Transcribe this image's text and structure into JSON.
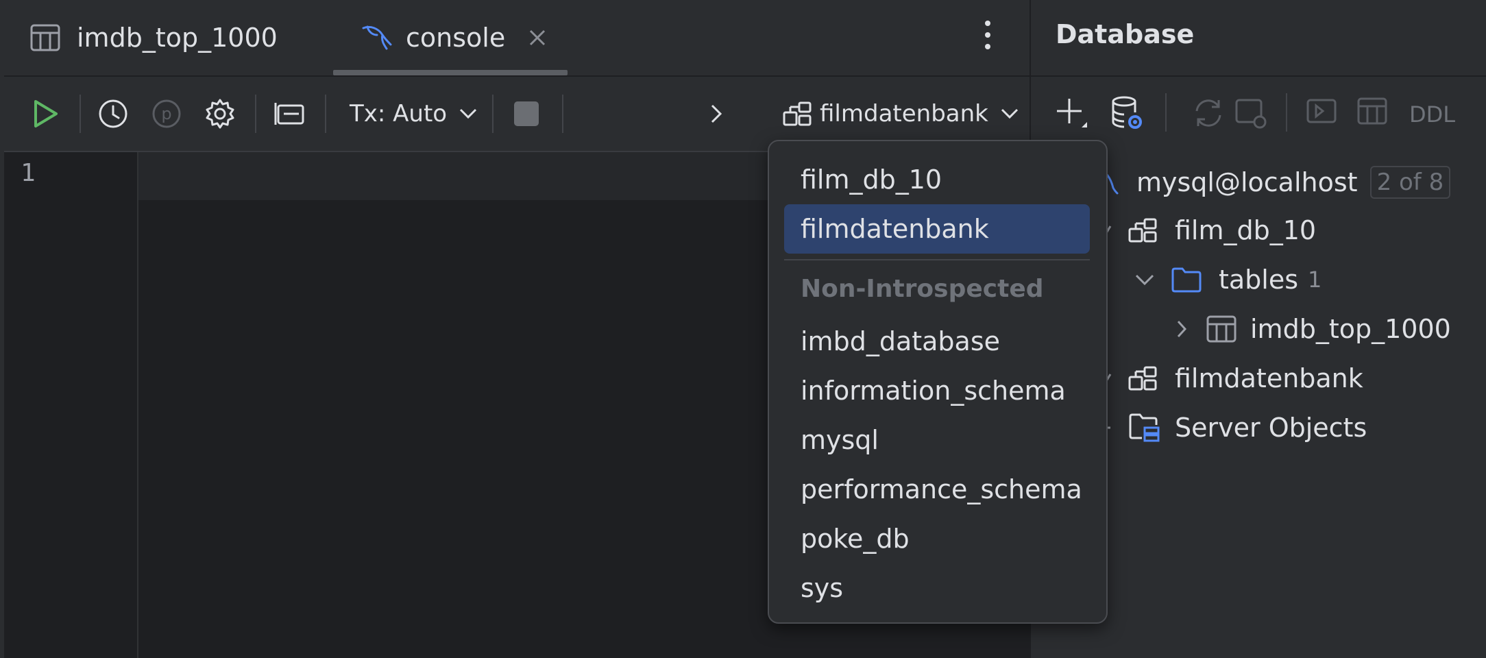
{
  "editor": {
    "tabs": [
      {
        "label": "imdb_top_1000",
        "icon": "table-icon",
        "active": false
      },
      {
        "label": "console",
        "icon": "mysql-dolphin-icon",
        "active": true
      }
    ],
    "toolbar": {
      "tx_mode": "Tx: Auto",
      "current_schema": "filmdatenbank",
      "icons": [
        "run-icon",
        "history-icon",
        "parameters-icon",
        "settings-icon",
        "layout-icon",
        "stop-icon",
        "chevron-right-icon",
        "schema-icon"
      ]
    },
    "line_numbers": [
      "1"
    ]
  },
  "schema_dropdown": {
    "introspected": [
      "film_db_10",
      "filmdatenbank"
    ],
    "selected": "filmdatenbank",
    "group_label": "Non-Introspected",
    "non_introspected": [
      "imbd_database",
      "information_schema",
      "mysql",
      "performance_schema",
      "poke_db",
      "sys"
    ]
  },
  "database_panel": {
    "title": "Database",
    "toolbar": {
      "ddl_label": "DDL"
    },
    "tree": {
      "connection": {
        "label": "mysql@localhost",
        "badge": "2 of 8"
      },
      "schemas": [
        {
          "label": "film_db_10",
          "children": [
            {
              "label": "tables",
              "count": "1",
              "children": [
                {
                  "label": "imdb_top_1000"
                }
              ]
            }
          ]
        },
        {
          "label": "filmdatenbank"
        }
      ],
      "server_objects": "Server Objects"
    }
  },
  "colors": {
    "selection": "#2e436e",
    "accent_blue": "#548af7",
    "run_green": "#5fb865"
  }
}
